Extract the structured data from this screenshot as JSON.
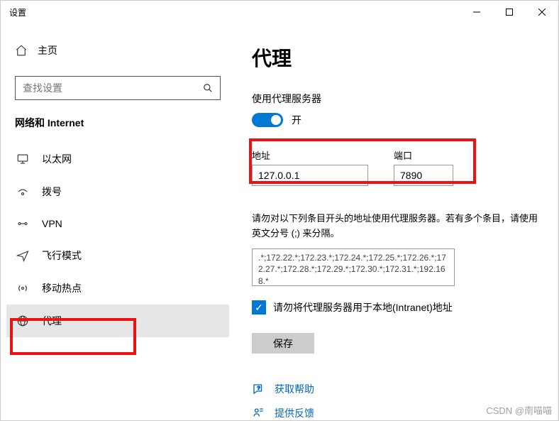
{
  "window": {
    "title": "设置"
  },
  "sidebar": {
    "home": "主页",
    "search_placeholder": "查找设置",
    "section": "网络和 Internet",
    "items": [
      {
        "label": "以太网"
      },
      {
        "label": "拨号"
      },
      {
        "label": "VPN"
      },
      {
        "label": "飞行模式"
      },
      {
        "label": "移动热点"
      },
      {
        "label": "代理"
      }
    ]
  },
  "main": {
    "title": "代理",
    "use_proxy_label": "使用代理服务器",
    "toggle_state": "开",
    "address_label": "地址",
    "address_value": "127.0.0.1",
    "port_label": "端口",
    "port_value": "7890",
    "exclude_note": "请勿对以下列条目开头的地址使用代理服务器。若有多个条目，请使用英文分号 (;) 来分隔。",
    "exclude_value": ".*;172.22.*;172.23.*;172.24.*;172.25.*;172.26.*;172.27.*;172.28.*;172.29.*;172.30.*;172.31.*;192.168.*",
    "bypass_local_label": "请勿将代理服务器用于本地(Intranet)地址",
    "save_label": "保存",
    "help_label": "获取帮助",
    "feedback_label": "提供反馈"
  },
  "watermark": "CSDN @南喵喵"
}
